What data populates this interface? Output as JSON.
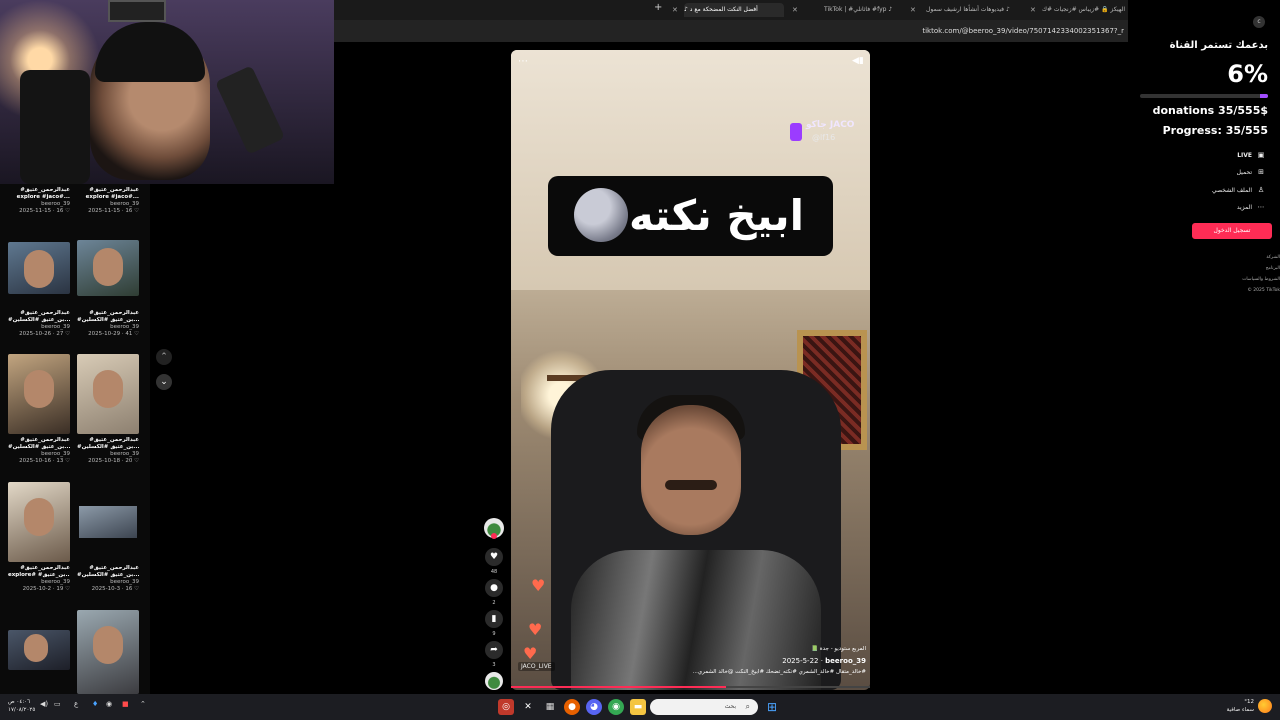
{
  "colors": {
    "accent": "#fe2c55",
    "goal": "#a24dff",
    "background": "#000000"
  },
  "browser": {
    "tabs": [
      {
        "label": "أفضل النكت المضحكة مع د",
        "active": true,
        "icon": "tiktok-icon"
      },
      {
        "label": "TikTok | #فاثانلي #fyp",
        "active": false,
        "icon": "tiktok-icon"
      },
      {
        "label": "فيديوهات أنشأها ارشيف سمول",
        "active": false,
        "icon": "tiktok-icon"
      },
      {
        "label": "الهيكز 🔒 #زيباس #زنجيات #ك",
        "active": false,
        "icon": "tiktok-icon"
      }
    ],
    "url": "tiktok.com/@beeroo_39/video/7507142334002351367?_r"
  },
  "left_videos": [
    {
      "title": "#عبدالرحمن_عتيق",
      "subtitle": "explore #jaco#...",
      "user": "beeroo_39",
      "stats": "2025-11-15 · 16 ♡"
    },
    {
      "title": "#عبدالرحمن_عتيق",
      "subtitle": "explore #jaco#...",
      "user": "beeroo_39",
      "stats": "2025-11-15 · 16 ♡"
    },
    {
      "title": "#عبدالرحمن_عتيق",
      "subtitle": "#بن_عتيق #الكسلين...",
      "user": "beeroo_39",
      "stats": "2025-10-26 · 27 ♡"
    },
    {
      "title": "#عبدالرحمن_عتيق",
      "subtitle": "#بن_عتيق #الكسلين...",
      "user": "beeroo_39",
      "stats": "2025-10-29 · 41 ♡"
    },
    {
      "title": "#عبدالرحمن_عتيق",
      "subtitle": "#بن_عتيق #الكسلين...",
      "user": "beeroo_39",
      "stats": "2025-10-16 · 13 ♡"
    },
    {
      "title": "#عبدالرحمن_عتيق",
      "subtitle": "#بن_عتيق #الكسلين...",
      "user": "beeroo_39",
      "stats": "2025-10-18 · 20 ♡"
    },
    {
      "title": "#عبدالرحمن_عتيق",
      "subtitle": "explore# #بن_عتيق...",
      "user": "beeroo_39",
      "stats": "2025-10-2 · 19 ♡"
    },
    {
      "title": "#عبدالرحمن_عتيق",
      "subtitle": "#بن_عتيق #الكسلين...",
      "user": "beeroo_39",
      "stats": "2025-10-3 · 16 ♡"
    }
  ],
  "video": {
    "caption": "ابيخ نكته",
    "watermark_name": "جاكو JACO",
    "watermark_handle": "@lf16",
    "live_tag": "JACO_LIVE",
    "location": "📗 المربع ستوديو - جدة",
    "author": "beeroo_39",
    "date": "2025-5-22",
    "description": "#خالد_متقال #خالد_الشمري #نكته_تضحك #ابيخ_النكت @خالد الشمري... ",
    "progress": 0.6
  },
  "actions": {
    "likes": "48",
    "comments": "2",
    "saves": "9",
    "shares": "3"
  },
  "sidebar": {
    "title": "بدعمك تستمر القناة",
    "percent": "6%",
    "goal_fraction": 0.06,
    "donations": "donations 35/555$",
    "progress_label": "Progress: 35/555",
    "nav": [
      {
        "label": "LIVE",
        "icon": "live-icon"
      },
      {
        "label": "تحميل",
        "icon": "upload-icon"
      },
      {
        "label": "الملف الشخصي",
        "icon": "profile-icon"
      },
      {
        "label": "المزيد",
        "icon": "more-icon"
      }
    ],
    "login": "تسجيل الدخول",
    "footer": [
      "الشركة",
      "البرنامج",
      "الشروط والسياسات",
      "© 2025 TikTok"
    ]
  },
  "taskbar": {
    "search_placeholder": "بحث",
    "time": "٠٤:٠٦ ص",
    "date": "١٧/٠٨/٢٠٢٥",
    "weather_temp": "°12",
    "weather_desc": "سماء صافية"
  }
}
